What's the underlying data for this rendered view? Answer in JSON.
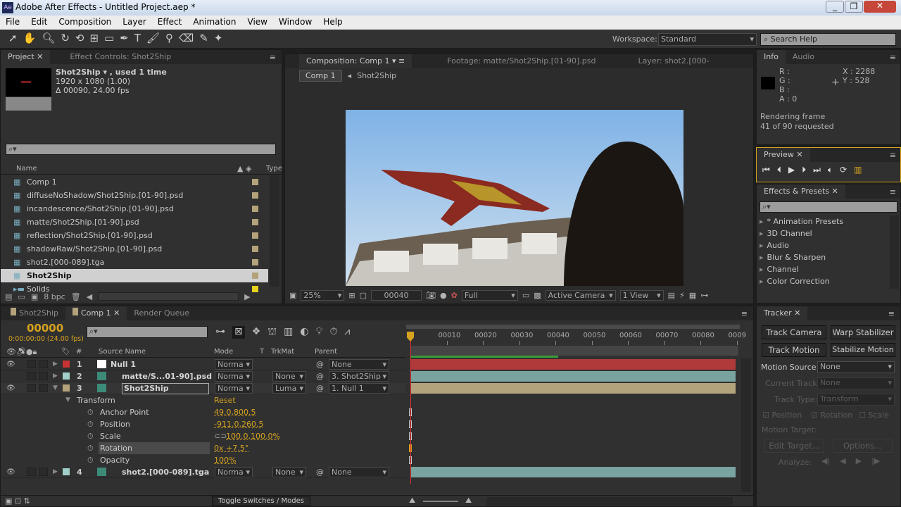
{
  "window": {
    "title": "Adobe After Effects - Untitled Project.aep *",
    "controls": [
      "minimize",
      "restore",
      "close"
    ]
  },
  "menu": [
    "File",
    "Edit",
    "Composition",
    "Layer",
    "Effect",
    "Animation",
    "View",
    "Window",
    "Help"
  ],
  "toolbar": {
    "workspace_label": "Workspace:",
    "workspace_value": "Standard",
    "search_placeholder": "Search Help"
  },
  "project": {
    "tabs": [
      "Project",
      "Effect Controls: Shot2Ship"
    ],
    "item_name": "Shot2Ship ▾ , used 1 time",
    "item_size": "1920 x 1080 (1.00)",
    "item_duration": "Δ 00090, 24.00 fps",
    "col_name": "Name",
    "col_type": "Type",
    "items": [
      {
        "name": "Comp 1",
        "color": "#b4a27a",
        "icon": "composition-icon"
      },
      {
        "name": "diffuseNoShadow/Shot2Ship.[01-90].psd",
        "color": "#b4a27a",
        "icon": "footage-icon"
      },
      {
        "name": "incandescence/Shot2Ship.[01-90].psd",
        "color": "#b4a27a",
        "icon": "footage-icon"
      },
      {
        "name": "matte/Shot2Ship.[01-90].psd",
        "color": "#b4a27a",
        "icon": "footage-icon"
      },
      {
        "name": "reflection/Shot2Ship.[01-90].psd",
        "color": "#b4a27a",
        "icon": "footage-icon"
      },
      {
        "name": "shadowRaw/Shot2Ship.[01-90].psd",
        "color": "#b4a27a",
        "icon": "footage-icon"
      },
      {
        "name": "shot2.[000-089].tga",
        "color": "#b4a27a",
        "icon": "footage-icon"
      },
      {
        "name": "Shot2Ship",
        "color": "#b4a27a",
        "icon": "footage-icon",
        "selected": true
      },
      {
        "name": "Solids",
        "color": "#e6d21e",
        "icon": "folder-icon"
      }
    ],
    "bpc": "8 bpc"
  },
  "viewer": {
    "tabs": [
      "Composition: Comp 1",
      "Footage: matte/Shot2Ship.[01-90].psd",
      "Layer: shot2.[000-"
    ],
    "breadcrumb": [
      "Comp 1",
      "Shot2Ship"
    ],
    "zoom": "25%",
    "timecode": "00040",
    "resolution": "Full",
    "camera": "Active Camera",
    "views": "1 View"
  },
  "info": {
    "tabs": [
      "Info",
      "Audio"
    ],
    "r": "R :",
    "g": "G :",
    "b": "B :",
    "a": "A : 0",
    "x": "X : 2288",
    "y": "Y : 528",
    "status1": "Rendering frame",
    "status2": "41 of 90 requested"
  },
  "preview": {
    "tab": "Preview"
  },
  "effects": {
    "tab": "Effects & Presets",
    "items": [
      "* Animation Presets",
      "3D Channel",
      "Audio",
      "Blur & Sharpen",
      "Channel",
      "Color Correction"
    ]
  },
  "timeline": {
    "tabs": [
      "Shot2Ship",
      "Comp 1",
      "Render Queue"
    ],
    "timecode": "00000",
    "timecode_sub": "0:00:00:00 (24.00 fps)",
    "columns": {
      "num": "#",
      "source": "Source Name",
      "mode": "Mode",
      "t": "T",
      "trkmat": "TrkMat",
      "parent": "Parent"
    },
    "ruler": [
      "00010",
      "00020",
      "00030",
      "00040",
      "00050",
      "00060",
      "00070",
      "00080",
      "0009"
    ],
    "layers": [
      {
        "num": "1",
        "name": "Null 1",
        "color": "#c83232",
        "mode": "Norma",
        "trkmat": "",
        "parent": "None",
        "bar": "#b03a3a",
        "visible": true
      },
      {
        "num": "2",
        "name": "matte/S...01-90].psd",
        "color": "#9fcfc8",
        "mode": "Norma",
        "trkmat": "None",
        "parent": "3. Shot2Ship",
        "bar": "#79a39e",
        "visible": false
      },
      {
        "num": "3",
        "name": "Shot2Ship",
        "color": "#b4a27a",
        "mode": "Norma",
        "trkmat": "Luma",
        "parent": "1. Null 1",
        "bar": "#b3a37c",
        "visible": true
      },
      {
        "num": "4",
        "name": "shot2.[000-089].tga",
        "color": "#9fcfc8",
        "mode": "Norma",
        "trkmat": "None",
        "parent": "None",
        "bar": "#79a39e",
        "visible": true
      }
    ],
    "transform": {
      "label": "Transform",
      "reset": "Reset",
      "props": [
        {
          "name": "Anchor Point",
          "value": "49.0,800.5"
        },
        {
          "name": "Position",
          "value": "-911.0,260.5"
        },
        {
          "name": "Scale",
          "value": "100.0,100.0%"
        },
        {
          "name": "Rotation",
          "value": "0x +7.5°",
          "selected": true
        },
        {
          "name": "Opacity",
          "value": "100%"
        }
      ]
    },
    "toggle_label": "Toggle Switches / Modes"
  },
  "tracker": {
    "tab": "Tracker",
    "track_camera": "Track Camera",
    "warp_stabilizer": "Warp Stabilizer",
    "track_motion": "Track Motion",
    "stabilize_motion": "Stabilize Motion",
    "motion_source_label": "Motion Source:",
    "motion_source": "None",
    "current_track_label": "Current Track:",
    "current_track": "None",
    "track_type_label": "Track Type:",
    "track_type": "Transform",
    "position": "Position",
    "rotation": "Rotation",
    "scale": "Scale",
    "motion_target": "Motion Target:",
    "edit_target": "Edit Target...",
    "options": "Options...",
    "analyze": "Analyze:"
  }
}
